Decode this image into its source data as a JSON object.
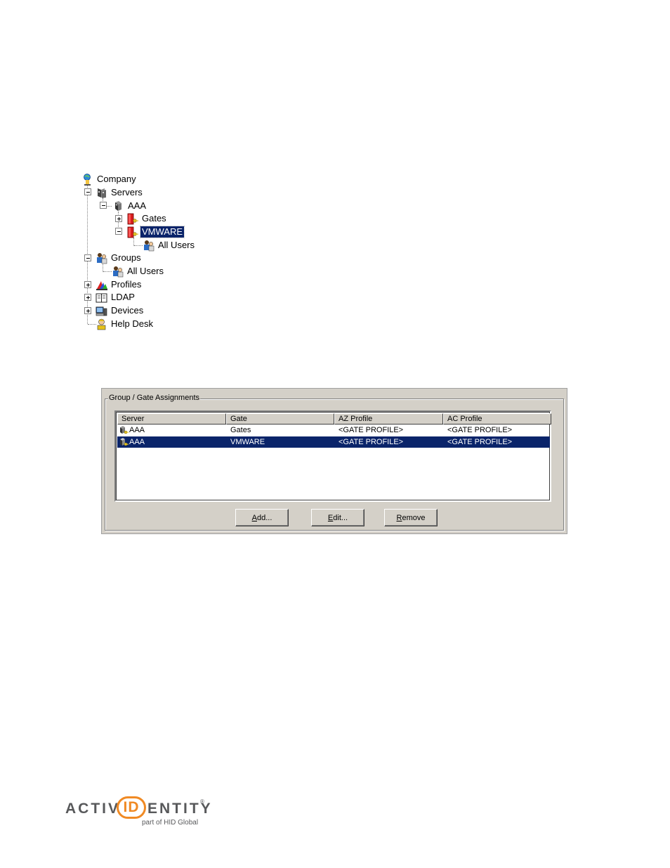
{
  "tree": {
    "nodes": [
      {
        "label": "Company",
        "icon": "globe-person-icon"
      },
      {
        "label": "Servers",
        "icon": "servers-icon"
      },
      {
        "label": "AAA",
        "icon": "server-icon"
      },
      {
        "label": "Gates",
        "icon": "gate-key-icon"
      },
      {
        "label": "VMWARE",
        "icon": "gate-key-icon",
        "selected": true
      },
      {
        "label": "All Users",
        "icon": "users-group-icon"
      },
      {
        "label": "Groups",
        "icon": "users-group-icon"
      },
      {
        "label": "All Users",
        "icon": "users-group-icon"
      },
      {
        "label": "Profiles",
        "icon": "profiles-icon"
      },
      {
        "label": "LDAP",
        "icon": "book-icon"
      },
      {
        "label": "Devices",
        "icon": "devices-icon"
      },
      {
        "label": "Help Desk",
        "icon": "helpdesk-person-icon"
      }
    ]
  },
  "assignments": {
    "title": "Group / Gate Assignments",
    "columns": [
      "Server",
      "Gate",
      "AZ Profile",
      "AC Profile"
    ],
    "rows": [
      {
        "server": "AAA",
        "gate": "Gates",
        "az": "<GATE PROFILE>",
        "ac": "<GATE PROFILE>"
      },
      {
        "server": "AAA",
        "gate": "VMWARE",
        "az": "<GATE PROFILE>",
        "ac": "<GATE PROFILE>",
        "selected": true
      }
    ],
    "buttons": {
      "add": {
        "mnemonic": "A",
        "rest": "dd..."
      },
      "edit": {
        "mnemonic": "E",
        "rest": "dit..."
      },
      "remove": {
        "mnemonic": "R",
        "rest": "emove"
      }
    }
  },
  "logo": {
    "text_a": "ACTIV",
    "text_id": "ID",
    "text_b": "ENTITY",
    "registered": "®",
    "tagline": "part of HID Global"
  },
  "colors": {
    "selection": "#0a246a",
    "face": "#d4d0c8",
    "logo_orange": "#f08a24",
    "logo_gray": "#58595b"
  }
}
